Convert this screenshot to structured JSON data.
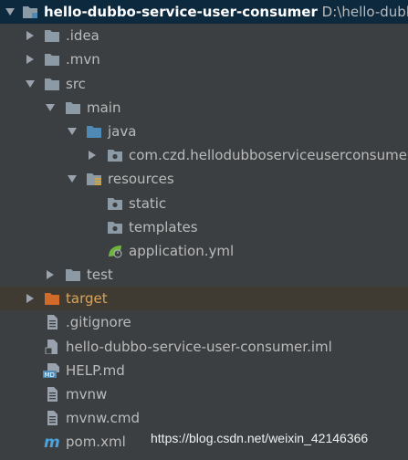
{
  "tree": {
    "root": {
      "name": "hello-dubbo-service-user-consumer",
      "path": "D:\\hello-dubbo\\"
    },
    "items": {
      "idea": ".idea",
      "mvn": ".mvn",
      "src": "src",
      "main": "main",
      "java": "java",
      "package": "com.czd.hellodubboserviceuserconsumer",
      "resources": "resources",
      "static": "static",
      "templates": "templates",
      "application_yml": "application.yml",
      "test": "test",
      "target": "target",
      "gitignore": ".gitignore",
      "iml": "hello-dubbo-service-user-consumer.iml",
      "help_md": "HELP.md",
      "mvnw": "mvnw",
      "mvnw_cmd": "mvnw.cmd",
      "pom_xml": "pom.xml"
    }
  },
  "watermark": "https://blog.csdn.net/weixin_42146366",
  "colors": {
    "background": "#3c3f41",
    "selected_row": "#0d293e",
    "excluded_row": "#3f3b32",
    "folder": "#8c9aa6",
    "source_folder": "#4f8ab7",
    "excluded_folder": "#d26a2a",
    "spring_leaf": "#6db33f"
  }
}
